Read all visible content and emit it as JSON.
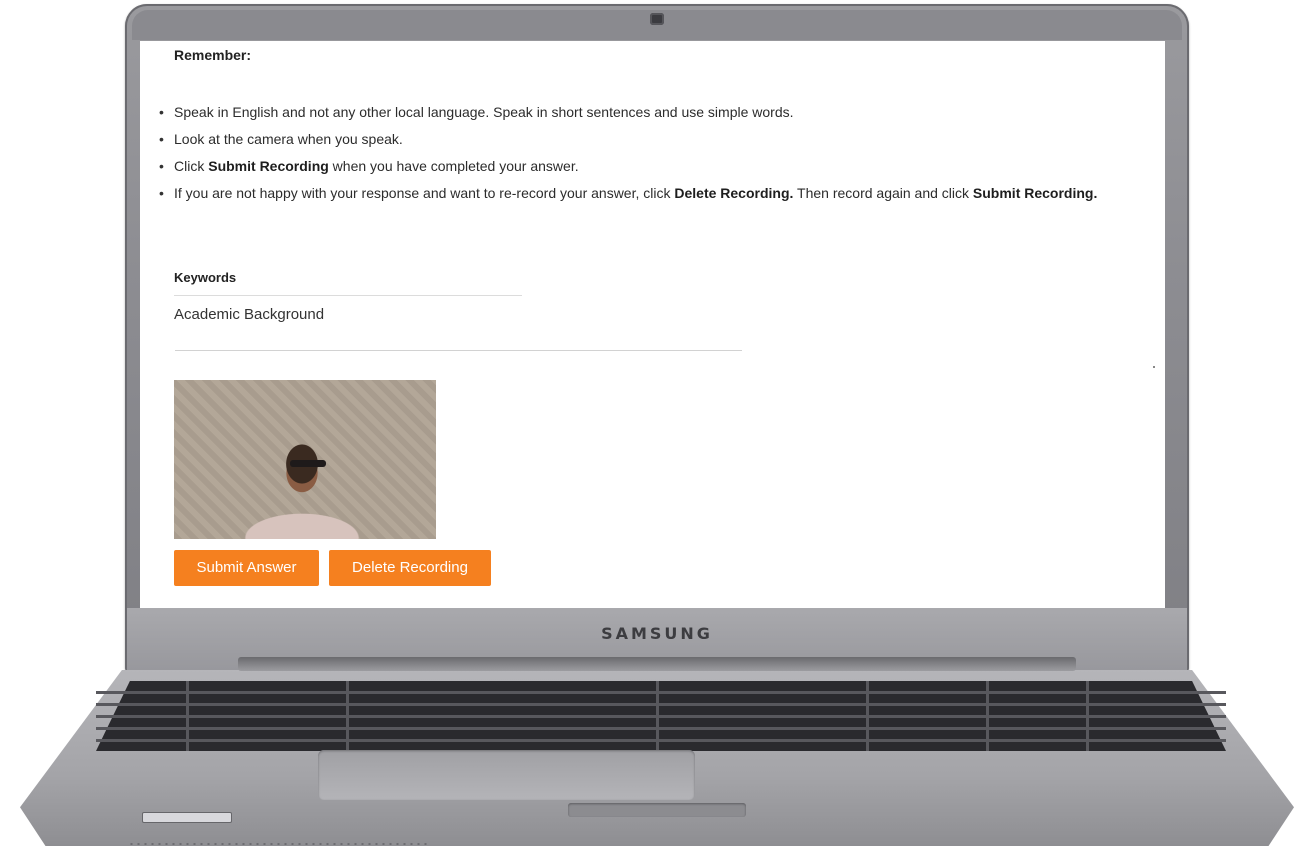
{
  "device": {
    "brand": "SAMSUNG"
  },
  "page": {
    "remember_heading": "Remember:",
    "rules": [
      {
        "before": "Speak in English and not any other local language. Speak in short sentences and use simple words.",
        "bold1": "",
        "middle": "",
        "bold2": "",
        "after": ""
      },
      {
        "before": "Look at the camera when you speak.",
        "bold1": "",
        "middle": "",
        "bold2": "",
        "after": ""
      },
      {
        "before": "Click ",
        "bold1": "Submit Recording",
        "middle": " when you have completed your answer.",
        "bold2": "",
        "after": ""
      },
      {
        "before": "If you are not happy with your response and want to re-record your answer, click ",
        "bold1": "Delete Recording.",
        "middle": " Then record again and click ",
        "bold2": "Submit Recording.",
        "after": ""
      }
    ],
    "keywords_heading": "Keywords",
    "keywords_value": "Academic Background"
  },
  "actions": {
    "submit_label": "Submit Answer",
    "delete_label": "Delete Recording"
  },
  "colors": {
    "button_bg": "#f5801f",
    "button_text": "#ffffff"
  }
}
